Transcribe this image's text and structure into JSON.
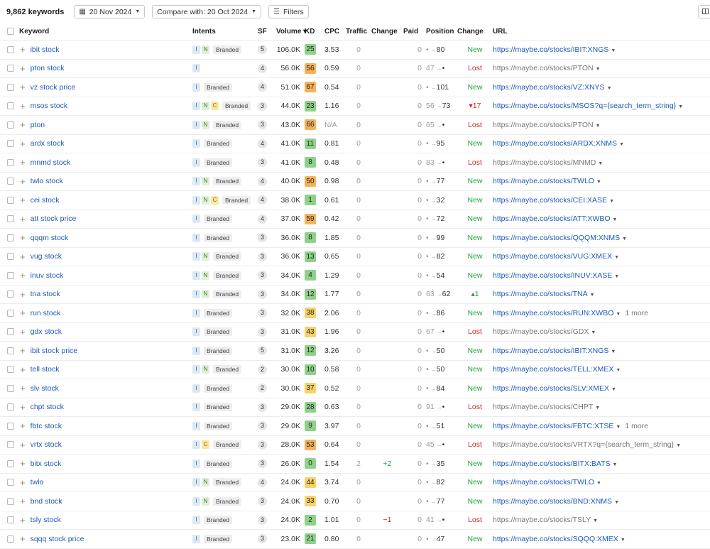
{
  "toolbar": {
    "keyword_count": "9,862 keywords",
    "date": "20 Nov 2024",
    "compare": "Compare with: 20 Oct 2024",
    "filters": "Filters"
  },
  "columns": {
    "keyword": "Keyword",
    "intents": "Intents",
    "sf": "SF",
    "volume": "Volume ▾",
    "kd": "KD",
    "cpc": "CPC",
    "traffic": "Traffic",
    "change": "Change",
    "paid": "Paid",
    "position": "Position",
    "pos_change": "Change",
    "url": "URL"
  },
  "colors": {
    "kd_green": "#8fd18a",
    "kd_yellow": "#f7d268",
    "kd_orange": "#f5b15a",
    "link": "#1c5ab8",
    "new": "#23a53a",
    "lost": "#c62a2a"
  },
  "rows": [
    {
      "kw": "ibit stock",
      "intents": [
        "I",
        "N"
      ],
      "branded": "Branded",
      "sf": "5",
      "vol": "106.0K",
      "kd": "25",
      "cpc": "3.53",
      "traffic": "0",
      "change": "",
      "paid": "0",
      "prev": "•",
      "cur": "80",
      "status": "New",
      "url": "https://maybe.co/stocks/IBIT:XNGS",
      "more": ""
    },
    {
      "kw": "pton stock",
      "intents": [
        "I"
      ],
      "branded": "",
      "sf": "4",
      "vol": "56.0K",
      "kd": "56",
      "cpc": "0.59",
      "traffic": "0",
      "change": "",
      "paid": "0",
      "prev": "47",
      "cur": "•",
      "status": "Lost",
      "url": "https://maybe.co/stocks/PTON",
      "more": ""
    },
    {
      "kw": "vz stock price",
      "intents": [
        "I"
      ],
      "branded": "Branded",
      "sf": "4",
      "vol": "51.0K",
      "kd": "67",
      "cpc": "0.54",
      "traffic": "0",
      "change": "",
      "paid": "0",
      "prev": "•",
      "cur": "101",
      "status": "New",
      "url": "https://maybe.co/stocks/VZ:XNYS",
      "more": ""
    },
    {
      "kw": "msos stock",
      "intents": [
        "I",
        "N",
        "C"
      ],
      "branded": "Branded",
      "sf": "3",
      "vol": "44.0K",
      "kd": "23",
      "cpc": "1.16",
      "traffic": "0",
      "change": "",
      "paid": "0",
      "prev": "56",
      "cur": "73",
      "status": "▾17",
      "url": "https://maybe.co/stocks/MSOS?q={search_term_string}",
      "more": ""
    },
    {
      "kw": "pton",
      "intents": [
        "I",
        "N"
      ],
      "branded": "Branded",
      "sf": "3",
      "vol": "43.0K",
      "kd": "66",
      "cpc": "N/A",
      "traffic": "0",
      "change": "",
      "paid": "0",
      "prev": "65",
      "cur": "•",
      "status": "Lost",
      "url": "https://maybe.co/stocks/PTON",
      "more": ""
    },
    {
      "kw": "ardx stock",
      "intents": [
        "I"
      ],
      "branded": "Branded",
      "sf": "4",
      "vol": "41.0K",
      "kd": "11",
      "cpc": "0.81",
      "traffic": "0",
      "change": "",
      "paid": "0",
      "prev": "•",
      "cur": "95",
      "status": "New",
      "url": "https://maybe.co/stocks/ARDX:XNMS",
      "more": ""
    },
    {
      "kw": "mnmd stock",
      "intents": [
        "I"
      ],
      "branded": "Branded",
      "sf": "3",
      "vol": "41.0K",
      "kd": "8",
      "cpc": "0.48",
      "traffic": "0",
      "change": "",
      "paid": "0",
      "prev": "83",
      "cur": "•",
      "status": "Lost",
      "url": "https://maybe.co/stocks/MNMD",
      "more": ""
    },
    {
      "kw": "twlo stock",
      "intents": [
        "I",
        "N"
      ],
      "branded": "Branded",
      "sf": "4",
      "vol": "40.0K",
      "kd": "50",
      "cpc": "0.98",
      "traffic": "0",
      "change": "",
      "paid": "0",
      "prev": "•",
      "cur": "77",
      "status": "New",
      "url": "https://maybe.co/stocks/TWLO",
      "more": ""
    },
    {
      "kw": "cei stock",
      "intents": [
        "I",
        "N",
        "C"
      ],
      "branded": "Branded",
      "sf": "4",
      "vol": "38.0K",
      "kd": "1",
      "cpc": "0.61",
      "traffic": "0",
      "change": "",
      "paid": "0",
      "prev": "•",
      "cur": "32",
      "status": "New",
      "url": "https://maybe.co/stocks/CEI:XASE",
      "more": ""
    },
    {
      "kw": "att stock price",
      "intents": [
        "I"
      ],
      "branded": "Branded",
      "sf": "4",
      "vol": "37.0K",
      "kd": "59",
      "cpc": "0.42",
      "traffic": "0",
      "change": "",
      "paid": "0",
      "prev": "•",
      "cur": "72",
      "status": "New",
      "url": "https://maybe.co/stocks/ATT:XWBO",
      "more": ""
    },
    {
      "kw": "qqqm stock",
      "intents": [
        "I"
      ],
      "branded": "Branded",
      "sf": "3",
      "vol": "36.0K",
      "kd": "8",
      "cpc": "1.85",
      "traffic": "0",
      "change": "",
      "paid": "0",
      "prev": "•",
      "cur": "99",
      "status": "New",
      "url": "https://maybe.co/stocks/QQQM:XNMS",
      "more": ""
    },
    {
      "kw": "vug stock",
      "intents": [
        "I",
        "N"
      ],
      "branded": "Branded",
      "sf": "3",
      "vol": "36.0K",
      "kd": "13",
      "cpc": "0.65",
      "traffic": "0",
      "change": "",
      "paid": "0",
      "prev": "•",
      "cur": "82",
      "status": "New",
      "url": "https://maybe.co/stocks/VUG:XMEX",
      "more": ""
    },
    {
      "kw": "inuv stock",
      "intents": [
        "I",
        "N"
      ],
      "branded": "Branded",
      "sf": "3",
      "vol": "34.0K",
      "kd": "4",
      "cpc": "1.29",
      "traffic": "0",
      "change": "",
      "paid": "0",
      "prev": "•",
      "cur": "54",
      "status": "New",
      "url": "https://maybe.co/stocks/INUV:XASE",
      "more": ""
    },
    {
      "kw": "tna stock",
      "intents": [
        "I",
        "N"
      ],
      "branded": "Branded",
      "sf": "3",
      "vol": "34.0K",
      "kd": "12",
      "cpc": "1.77",
      "traffic": "0",
      "change": "",
      "paid": "0",
      "prev": "63",
      "cur": "62",
      "status": "▴1",
      "url": "https://maybe.co/stocks/TNA",
      "more": ""
    },
    {
      "kw": "run stock",
      "intents": [
        "I"
      ],
      "branded": "Branded",
      "sf": "3",
      "vol": "32.0K",
      "kd": "38",
      "cpc": "2.06",
      "traffic": "0",
      "change": "",
      "paid": "0",
      "prev": "•",
      "cur": "86",
      "status": "New",
      "url": "https://maybe.co/stocks/RUN:XWBO",
      "more": "1 more"
    },
    {
      "kw": "gdx stock",
      "intents": [
        "I"
      ],
      "branded": "Branded",
      "sf": "3",
      "vol": "31.0K",
      "kd": "43",
      "cpc": "1.96",
      "traffic": "0",
      "change": "",
      "paid": "0",
      "prev": "67",
      "cur": "•",
      "status": "Lost",
      "url": "https://maybe.co/stocks/GDX",
      "more": ""
    },
    {
      "kw": "ibit stock price",
      "intents": [
        "I"
      ],
      "branded": "Branded",
      "sf": "5",
      "vol": "31.0K",
      "kd": "12",
      "cpc": "3.26",
      "traffic": "0",
      "change": "",
      "paid": "0",
      "prev": "•",
      "cur": "50",
      "status": "New",
      "url": "https://maybe.co/stocks/IBIT:XNGS",
      "more": ""
    },
    {
      "kw": "tell stock",
      "intents": [
        "I",
        "N"
      ],
      "branded": "Branded",
      "sf": "2",
      "vol": "30.0K",
      "kd": "10",
      "cpc": "0.58",
      "traffic": "0",
      "change": "",
      "paid": "0",
      "prev": "•",
      "cur": "50",
      "status": "New",
      "url": "https://maybe.co/stocks/TELL:XMEX",
      "more": ""
    },
    {
      "kw": "slv stock",
      "intents": [
        "I"
      ],
      "branded": "Branded",
      "sf": "2",
      "vol": "30.0K",
      "kd": "37",
      "cpc": "0.52",
      "traffic": "0",
      "change": "",
      "paid": "0",
      "prev": "•",
      "cur": "84",
      "status": "New",
      "url": "https://maybe.co/stocks/SLV:XMEX",
      "more": ""
    },
    {
      "kw": "chpt stock",
      "intents": [
        "I"
      ],
      "branded": "Branded",
      "sf": "3",
      "vol": "29.0K",
      "kd": "28",
      "cpc": "0.63",
      "traffic": "0",
      "change": "",
      "paid": "0",
      "prev": "91",
      "cur": "•",
      "status": "Lost",
      "url": "https://maybe.co/stocks/CHPT",
      "more": ""
    },
    {
      "kw": "fbtc stock",
      "intents": [
        "I"
      ],
      "branded": "Branded",
      "sf": "3",
      "vol": "29.0K",
      "kd": "9",
      "cpc": "3.97",
      "traffic": "0",
      "change": "",
      "paid": "0",
      "prev": "•",
      "cur": "51",
      "status": "New",
      "url": "https://maybe.co/stocks/FBTC:XTSE",
      "more": "1 more"
    },
    {
      "kw": "vrtx stock",
      "intents": [
        "I",
        "C"
      ],
      "branded": "Branded",
      "sf": "3",
      "vol": "28.0K",
      "kd": "53",
      "cpc": "0.64",
      "traffic": "0",
      "change": "",
      "paid": "0",
      "prev": "45",
      "cur": "•",
      "status": "Lost",
      "url": "https://maybe.co/stocks/VRTX?q={search_term_string}",
      "more": ""
    },
    {
      "kw": "bitx stock",
      "intents": [
        "I"
      ],
      "branded": "Branded",
      "sf": "3",
      "vol": "26.0K",
      "kd": "0",
      "cpc": "1.54",
      "traffic": "2",
      "change": "+2",
      "paid": "0",
      "prev": "•",
      "cur": "35",
      "status": "New",
      "url": "https://maybe.co/stocks/BITX:BATS",
      "more": ""
    },
    {
      "kw": "twlo",
      "intents": [
        "I",
        "N"
      ],
      "branded": "Branded",
      "sf": "4",
      "vol": "24.0K",
      "kd": "44",
      "cpc": "3.74",
      "traffic": "0",
      "change": "",
      "paid": "0",
      "prev": "•",
      "cur": "82",
      "status": "New",
      "url": "https://maybe.co/stocks/TWLO",
      "more": ""
    },
    {
      "kw": "bnd stock",
      "intents": [
        "I",
        "N"
      ],
      "branded": "Branded",
      "sf": "3",
      "vol": "24.0K",
      "kd": "33",
      "cpc": "0.70",
      "traffic": "0",
      "change": "",
      "paid": "0",
      "prev": "•",
      "cur": "77",
      "status": "New",
      "url": "https://maybe.co/stocks/BND:XNMS",
      "more": ""
    },
    {
      "kw": "tsly stock",
      "intents": [
        "I"
      ],
      "branded": "Branded",
      "sf": "3",
      "vol": "24.0K",
      "kd": "2",
      "cpc": "1.01",
      "traffic": "0",
      "change": "−1",
      "paid": "0",
      "prev": "41",
      "cur": "•",
      "status": "Lost",
      "url": "https://maybe.co/stocks/TSLY",
      "more": ""
    },
    {
      "kw": "sqqq stock price",
      "intents": [
        "I"
      ],
      "branded": "Branded",
      "sf": "3",
      "vol": "23.0K",
      "kd": "21",
      "cpc": "0.80",
      "traffic": "0",
      "change": "",
      "paid": "0",
      "prev": "•",
      "cur": "47",
      "status": "New",
      "url": "https://maybe.co/stocks/SQQQ:XMEX",
      "more": ""
    }
  ]
}
